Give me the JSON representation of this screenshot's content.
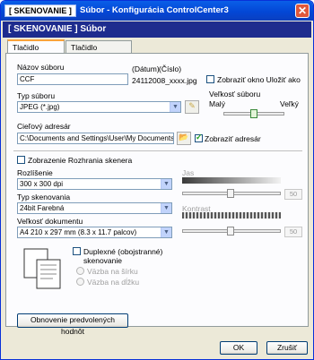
{
  "titlebar": {
    "app": "[ SKENOVANIE ]",
    "title": "Súbor - Konfigurácia ControlCenter3"
  },
  "header": {
    "title": "[ SKENOVANIE ]   Súbor"
  },
  "tabs": [
    {
      "label": "Tlačidlo softvéru",
      "active": true
    },
    {
      "label": "Tlačidlo zariadenia",
      "active": false
    }
  ],
  "file": {
    "name_label": "Názov súboru",
    "name_value": "CCF",
    "date_label": "(Dátum)",
    "number_label": "(Číslo)",
    "date_number_value": "24112008_xxxx.jpg",
    "show_save_as_label": "Zobraziť okno Uložiť ako",
    "show_save_as_checked": false
  },
  "filetype": {
    "label": "Typ súboru",
    "value": "JPEG (*.jpg)"
  },
  "filesize": {
    "label": "Veľkosť súboru",
    "small": "Malý",
    "large": "Veľký",
    "level": 0.5
  },
  "target": {
    "label": "Cieľový adresár",
    "value": "C:\\Documents and Settings\\User\\My Documents\\My",
    "show_folder_label": "Zobraziť adresár",
    "show_folder_checked": true
  },
  "scan": {
    "show_interface_label": "Zobrazenie Rozhrania skenera",
    "show_interface_checked": false,
    "resolution_label": "Rozlíšenie",
    "resolution_value": "300 x 300 dpi",
    "scantype_label": "Typ skenovania",
    "scantype_value": "24bit Farebná",
    "docsize_label": "Veľkosť dokumentu",
    "docsize_value": "A4 210 x 297 mm (8.3 x 11.7 palcov)",
    "brightness_label": "Jas",
    "brightness_value": "50",
    "contrast_label": "Kontrast",
    "contrast_value": "50",
    "duplex_label": "Duplexné (obojstranné) skenovanie",
    "duplex_checked": false,
    "long_edge_label": "Väzba na šírku",
    "short_edge_label": "Väzba na dĺžku"
  },
  "buttons": {
    "restore": "Obnovenie predvolených hodnôt",
    "ok": "OK",
    "cancel": "Zrušiť"
  },
  "colors": {
    "titlebar": "#0a5fe8",
    "header": "#1e2c8e",
    "window_bg": "#ece9d8"
  }
}
